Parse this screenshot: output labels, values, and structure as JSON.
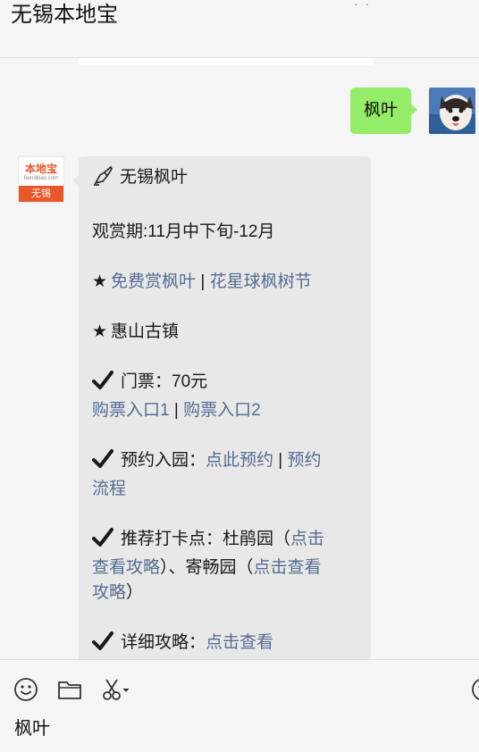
{
  "window": {
    "title": "无锡本地宝"
  },
  "outgoing": {
    "text": "枫叶"
  },
  "incoming": {
    "logo": {
      "top": "本地宝",
      "sub": "Bendibao.com",
      "city": "无锡"
    },
    "heading": "无锡枫叶",
    "season": "观赏期:11月中下旬-12月",
    "links_row1": {
      "link1": "免费赏枫叶",
      "sep": " | ",
      "link2": "花星球枫树节"
    },
    "place": "惠山古镇",
    "ticket": {
      "label": "门票：70元",
      "link1": "购票入口1",
      "sep": " | ",
      "link2": "购票入口2"
    },
    "reserve": {
      "label": "预约入园：",
      "link1": "点此预约",
      "sep": " | ",
      "link2a": "预约",
      "link2b": "流程"
    },
    "spots": {
      "prefix": "推荐打卡点：杜鹃园（",
      "link1a": "点击",
      "link1b": "查看攻略",
      "mid": "）、寄畅园（",
      "link2a": "点击查看",
      "link2b": "攻略",
      "suffix": "）"
    },
    "guide": {
      "label": "详细攻略：",
      "link": "点击查看"
    }
  },
  "toolbar": {
    "icons": [
      "emoji-icon",
      "folder-icon",
      "scissors-icon",
      "emoji-right-icon"
    ],
    "input_value": "枫叶"
  },
  "colors": {
    "link": "#576b95",
    "outgoing_bubble": "#95ec69",
    "incoming_bubble": "#e8e8e8",
    "brand": "#e8582a"
  }
}
